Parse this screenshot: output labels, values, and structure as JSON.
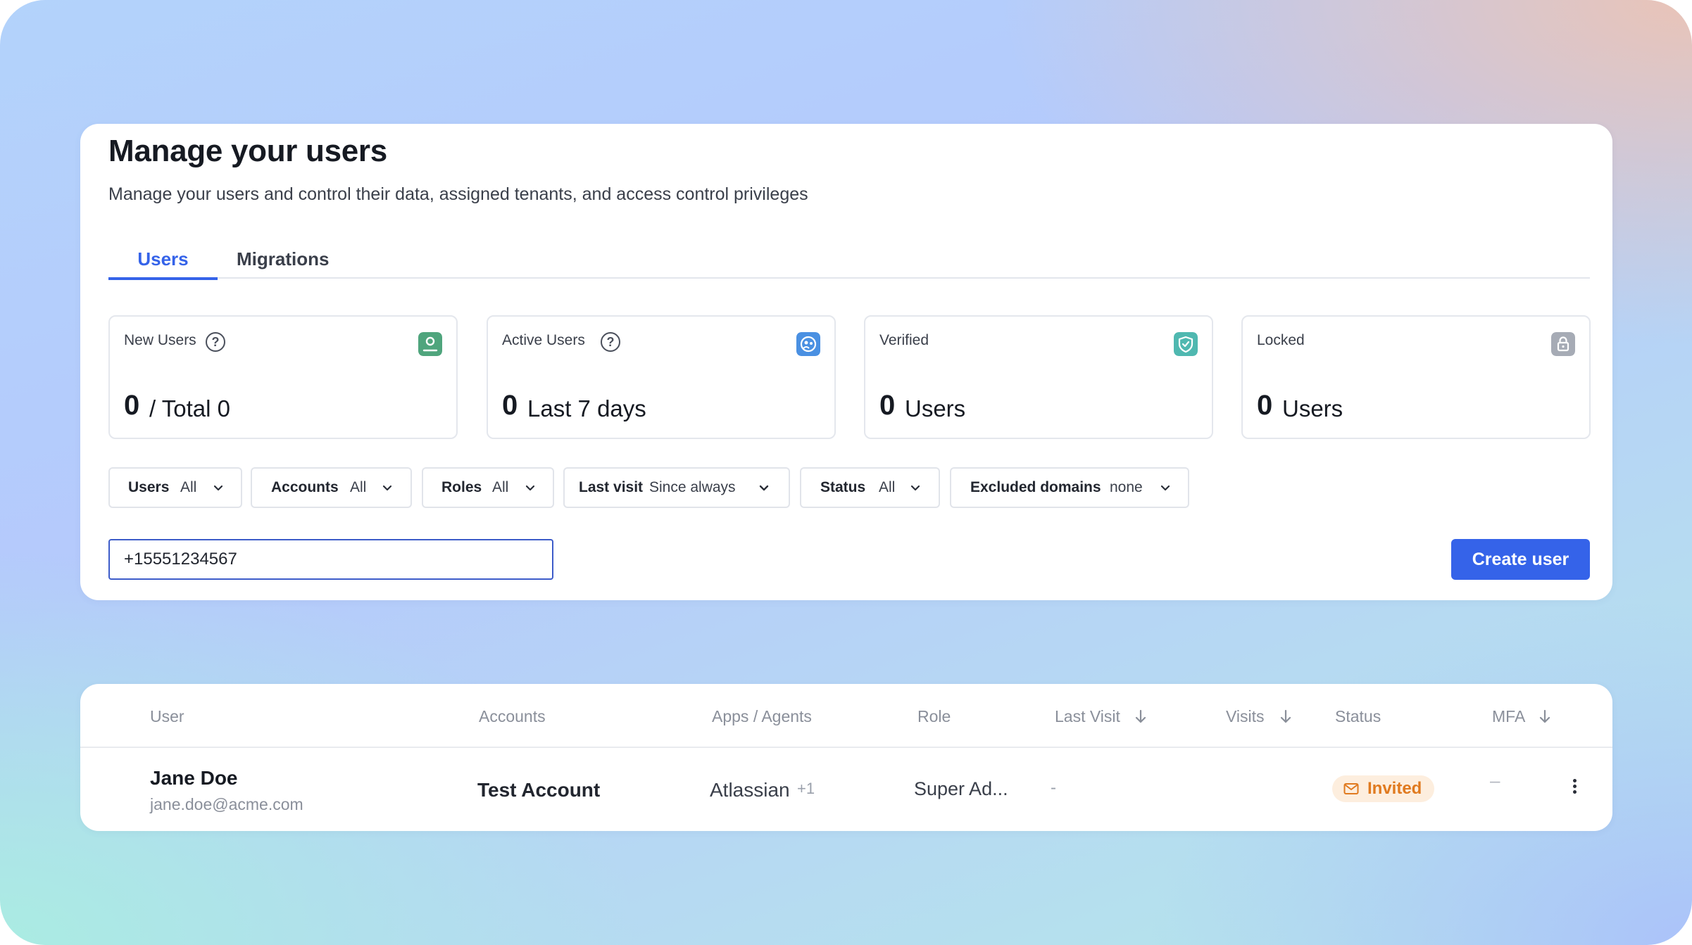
{
  "header": {
    "title": "Manage your users",
    "subtitle": "Manage your users and control their data, assigned tenants, and access control privileges"
  },
  "tabs": [
    {
      "label": "Users",
      "active": true
    },
    {
      "label": "Migrations",
      "active": false
    }
  ],
  "stats": [
    {
      "label": "New Users",
      "help": "?",
      "value": "0",
      "text": "/ Total 0",
      "icon": "user-badge-icon",
      "icon_color": "#4fa57d"
    },
    {
      "label": "Active Users",
      "help": "?",
      "value": "0",
      "text": "Last 7 days",
      "icon": "active-users-icon",
      "icon_color": "#4a90e2"
    },
    {
      "label": "Verified",
      "value": "0",
      "text": "Users",
      "icon": "shield-check-icon",
      "icon_color": "#4fb8b0"
    },
    {
      "label": "Locked",
      "value": "0",
      "text": "Users",
      "icon": "lock-icon",
      "icon_color": "#a6abb5"
    }
  ],
  "filters": [
    {
      "name": "Users",
      "value": "All"
    },
    {
      "name": "Accounts",
      "value": "All"
    },
    {
      "name": "Roles",
      "value": "All"
    },
    {
      "name": "Last visit",
      "value": "Since always"
    },
    {
      "name": "Status",
      "value": "All"
    },
    {
      "name": "Excluded domains",
      "value": "none"
    }
  ],
  "search": {
    "value": "+15551234567"
  },
  "actions": {
    "create_user": "Create user"
  },
  "table": {
    "columns": {
      "user": "User",
      "accounts": "Accounts",
      "apps": "Apps / Agents",
      "role": "Role",
      "last_visit": "Last Visit",
      "visits": "Visits",
      "status": "Status",
      "mfa": "MFA"
    },
    "rows": [
      {
        "name": "Jane Doe",
        "email": "jane.doe@acme.com",
        "account": "Test Account",
        "app": "Atlassian",
        "app_more": "+1",
        "role": "Super Ad...",
        "last_visit": "-",
        "status": "Invited",
        "mfa": "–"
      }
    ]
  },
  "colors": {
    "accent": "#3563e9",
    "invited_text": "#e07a1f",
    "invited_bg": "#fdeede"
  }
}
